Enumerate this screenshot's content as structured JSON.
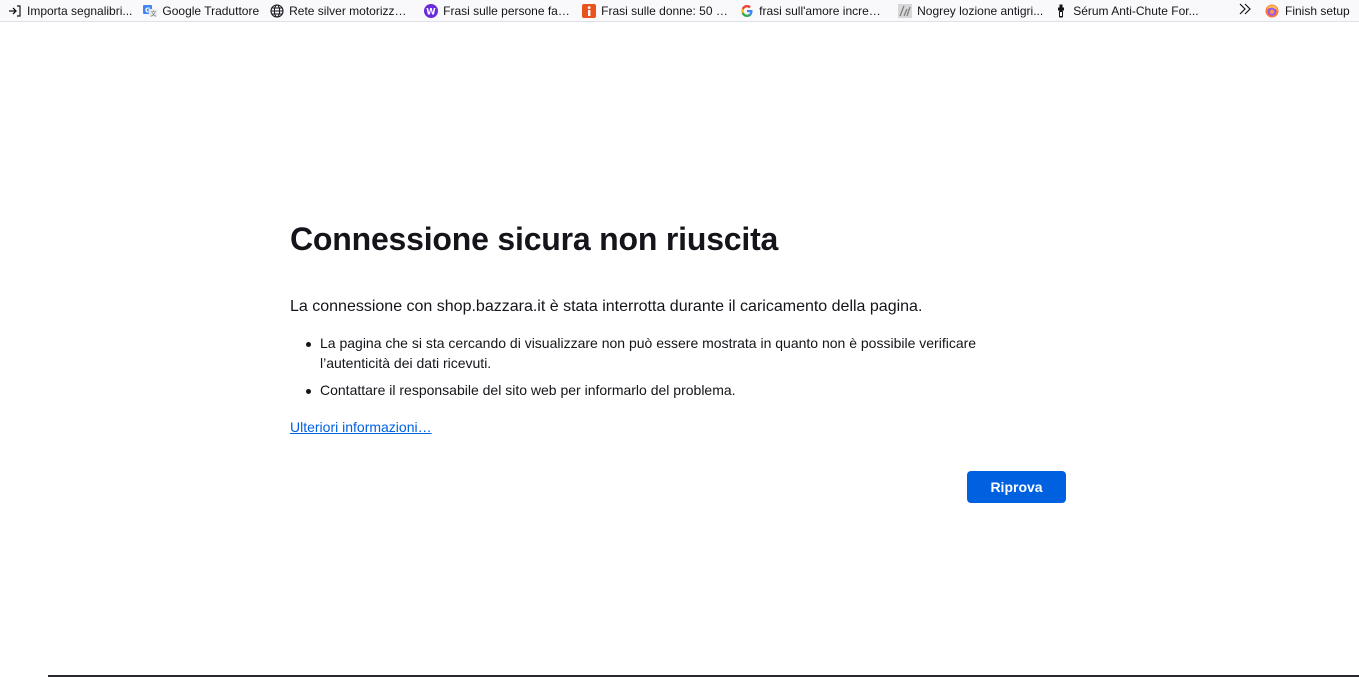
{
  "bookmarks": [
    {
      "label": "Importa segnalibri...",
      "icon": "import-icon",
      "width": 106
    },
    {
      "label": "Google Traduttore",
      "icon": "google-translate-icon",
      "width": 98
    },
    {
      "label": "Rete silver motorizzat...",
      "icon": "globe-icon",
      "width": 124
    },
    {
      "label": "Frasi sulle persone fals...",
      "icon": "w-badge-icon",
      "width": 128
    },
    {
      "label": "Frasi sulle donne: 50 ci...",
      "icon": "info-orange-icon",
      "width": 128
    },
    {
      "label": "frasi sull'amore incredi...",
      "icon": "google-g-icon",
      "width": 128
    },
    {
      "label": "Nogrey lozione antigri...",
      "icon": "nogrey-icon",
      "width": 128
    },
    {
      "label": "Sérum Anti-Chute For...",
      "icon": "serum-icon",
      "width": 126
    }
  ],
  "overflow": {
    "icon": "chevron-double-right-icon"
  },
  "finish_setup": {
    "label": "Finish setup",
    "icon": "firefox-icon"
  },
  "error": {
    "title": "Connessione sicura non riuscita",
    "intro": "La connessione con shop.bazzara.it è stata interrotta durante il caricamento della pagina.",
    "bullets": [
      "La pagina che si sta cercando di visualizzare non può essere mostrata in quanto non è possibile verificare l’autenticità dei dati ricevuti.",
      "Contattare il responsabile del sito web per informarlo del problema."
    ],
    "learn_more": "Ulteriori informazioni…",
    "retry_label": "Riprova"
  },
  "colors": {
    "accent": "#0061e0",
    "text": "#15141a",
    "background": "#ffffff",
    "toolbar": "#f9f9fb"
  }
}
